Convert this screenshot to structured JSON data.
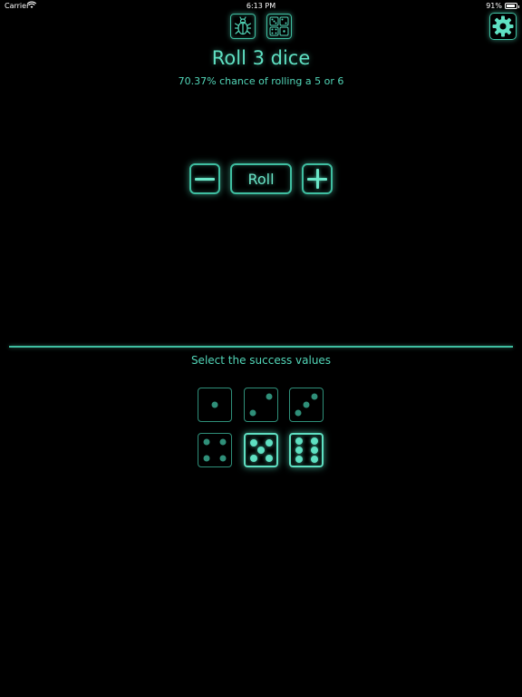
{
  "status_bar": {
    "carrier": "Carrier",
    "time": "6:13 PM",
    "battery": "91%",
    "battery_level": 0.91
  },
  "toolbar": {
    "left_icon": "bug-icon",
    "right_icon": "dice-grid-icon",
    "settings_icon": "gear-icon"
  },
  "header": {
    "title": "Roll 3 dice",
    "subtitle": "70.37% chance of rolling a 5 or 6"
  },
  "controls": {
    "roll_label": "Roll"
  },
  "success_panel": {
    "label": "Select the success values",
    "dice": [
      {
        "value": 1,
        "selected": false
      },
      {
        "value": 2,
        "selected": false
      },
      {
        "value": 3,
        "selected": false
      },
      {
        "value": 4,
        "selected": false
      },
      {
        "value": 5,
        "selected": true
      },
      {
        "value": 6,
        "selected": true
      }
    ]
  },
  "colors": {
    "accent": "#52d6b8",
    "background": "#000000"
  }
}
